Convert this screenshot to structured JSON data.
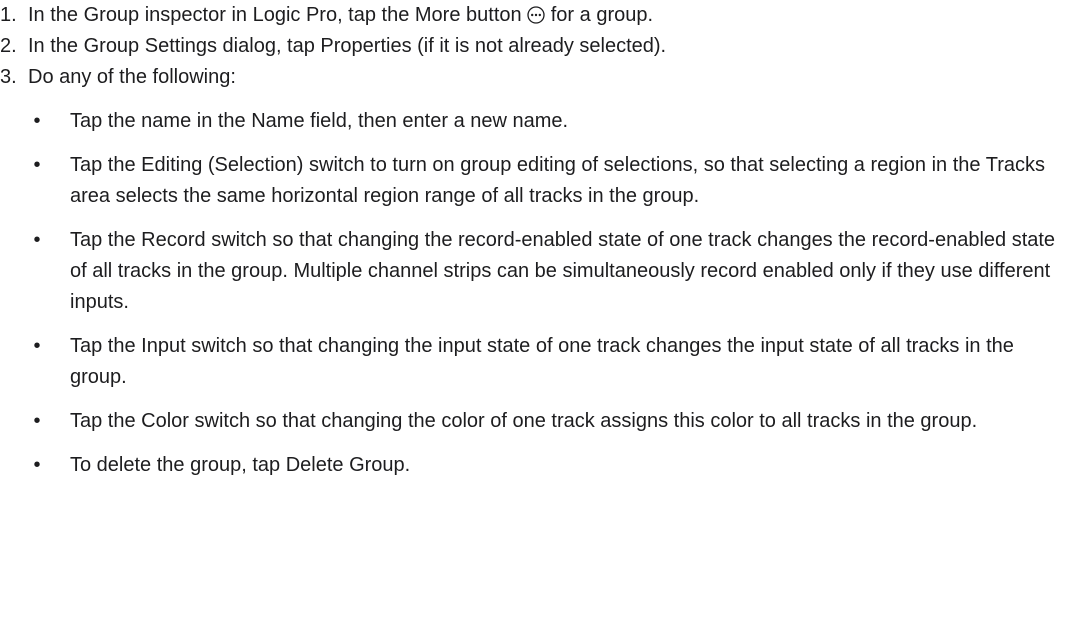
{
  "steps": [
    {
      "number": "1.",
      "text_before_icon": "In the Group inspector in Logic Pro, tap the More button ",
      "icon": "more-ellipsis-circle-icon",
      "text_after_icon": " for a group."
    },
    {
      "number": "2.",
      "text": "In the Group Settings dialog, tap Properties (if it is not already selected)."
    },
    {
      "number": "3.",
      "text": "Do any of the following:",
      "bullets": [
        "Tap the name in the Name field, then enter a new name.",
        "Tap the Editing (Selection) switch to turn on group editing of selections, so that selecting a region in the Tracks area selects the same horizontal region range of all tracks in the group.",
        "Tap the Record switch so that changing the record-enabled state of one track changes the record-enabled state of all tracks in the group. Multiple channel strips can be simultaneously record enabled only if they use different inputs.",
        "Tap the Input switch so that changing the input state of one track changes the input state of all tracks in the group.",
        "Tap the Color switch so that changing the color of one track assigns this color to all tracks in the group.",
        "To delete the group, tap Delete Group."
      ]
    }
  ],
  "bullet_glyph": "•",
  "colors": {
    "text": "#1d1d1f",
    "icon_stroke": "#1d1d1f"
  }
}
